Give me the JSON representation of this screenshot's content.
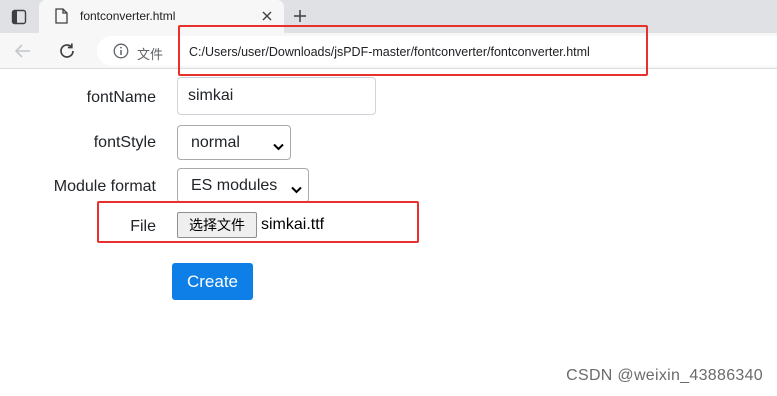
{
  "browser": {
    "tab": {
      "title": "fontconverter.html",
      "favicon": "page-icon",
      "close_icon": "close-icon"
    },
    "new_tab_icon": "plus-icon",
    "tab_actions_icon": "tab-actions-icon",
    "back_icon": "arrow-left-icon",
    "reload_icon": "reload-icon",
    "address": {
      "info_icon": "info-icon",
      "site_label": "文件",
      "url": "C:/Users/user/Downloads/jsPDF-master/fontconverter/fontconverter.html"
    }
  },
  "form": {
    "font_name": {
      "label": "fontName",
      "value": "simkai"
    },
    "font_style": {
      "label": "fontStyle",
      "selected": "normal"
    },
    "module_format": {
      "label": "Module format",
      "selected": "ES modules"
    },
    "file": {
      "label": "File",
      "button_label": "选择文件",
      "file_name": "simkai.ttf"
    },
    "create_label": "Create"
  },
  "annotations": {
    "highlight_color": "#e8302d"
  },
  "watermark": "CSDN @weixin_43886340",
  "colors": {
    "primary_button": "#0d7fe6"
  }
}
